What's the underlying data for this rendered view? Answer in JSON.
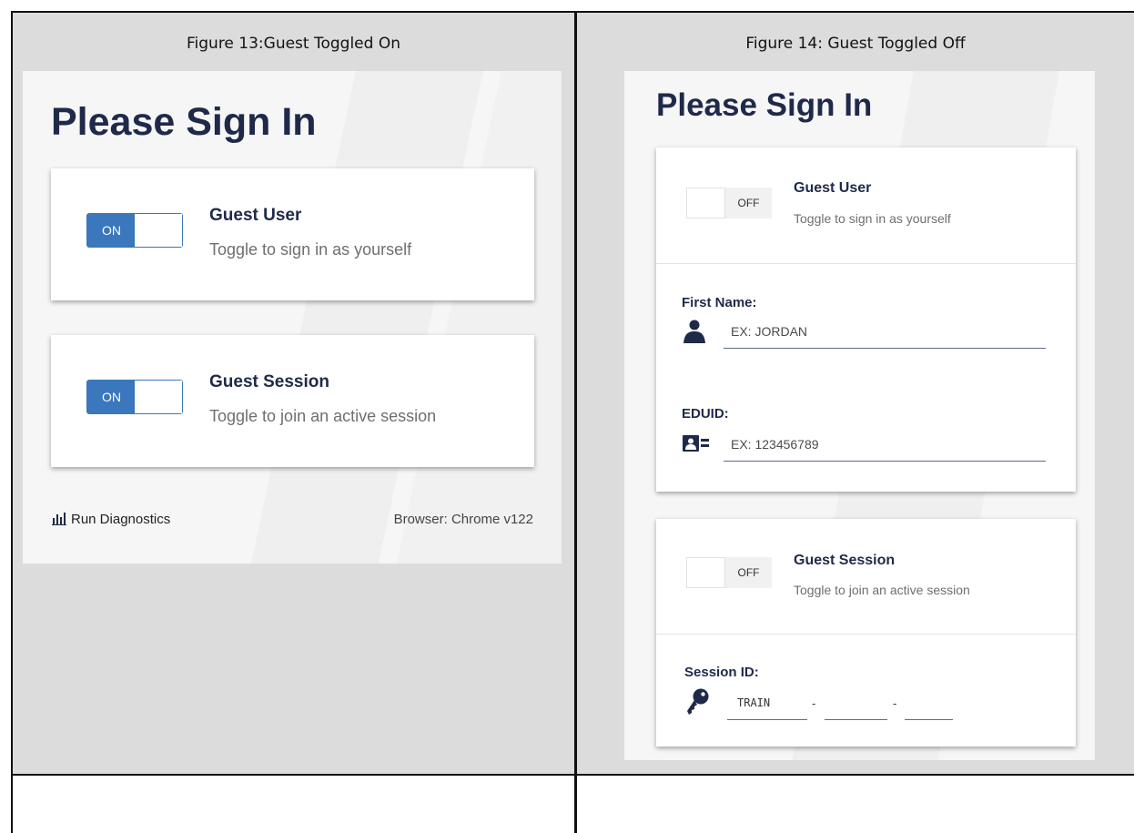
{
  "figures": [
    {
      "caption": "Figure 13:Guest Toggled On"
    },
    {
      "caption": "Figure 14: Guest Toggled Off"
    }
  ],
  "left_panel": {
    "title": "Please Sign In",
    "guest_user": {
      "toggle_label": "ON",
      "heading": "Guest User",
      "subtitle": "Toggle to sign in as yourself"
    },
    "guest_session": {
      "toggle_label": "ON",
      "heading": "Guest Session",
      "subtitle": "Toggle to join an active session"
    },
    "footer": {
      "diagnostics_label": "Run Diagnostics",
      "browser_text": "Browser: Chrome v122"
    },
    "icons": {
      "diagnostics": "bar-chart-icon"
    }
  },
  "right_panel": {
    "title": "Please Sign In",
    "guest_user": {
      "toggle_label": "OFF",
      "heading": "Guest User",
      "subtitle": "Toggle to sign in as yourself",
      "first_name": {
        "label": "First Name:",
        "placeholder": "EX: JORDAN"
      },
      "eduid": {
        "label": "EDUID:",
        "placeholder": "EX: 123456789"
      }
    },
    "guest_session": {
      "toggle_label": "OFF",
      "heading": "Guest Session",
      "subtitle": "Toggle to join an active session",
      "session_id": {
        "label": "Session ID:",
        "prefix_value": "TRAIN",
        "separator": "-"
      }
    },
    "icons": {
      "first_name": "person-icon",
      "eduid": "id-card-icon",
      "session_id": "key-icon"
    }
  },
  "colors": {
    "brand_navy": "#1f2a4a",
    "toggle_blue": "#3a77bc",
    "cell_gray": "#dcdcdc"
  }
}
